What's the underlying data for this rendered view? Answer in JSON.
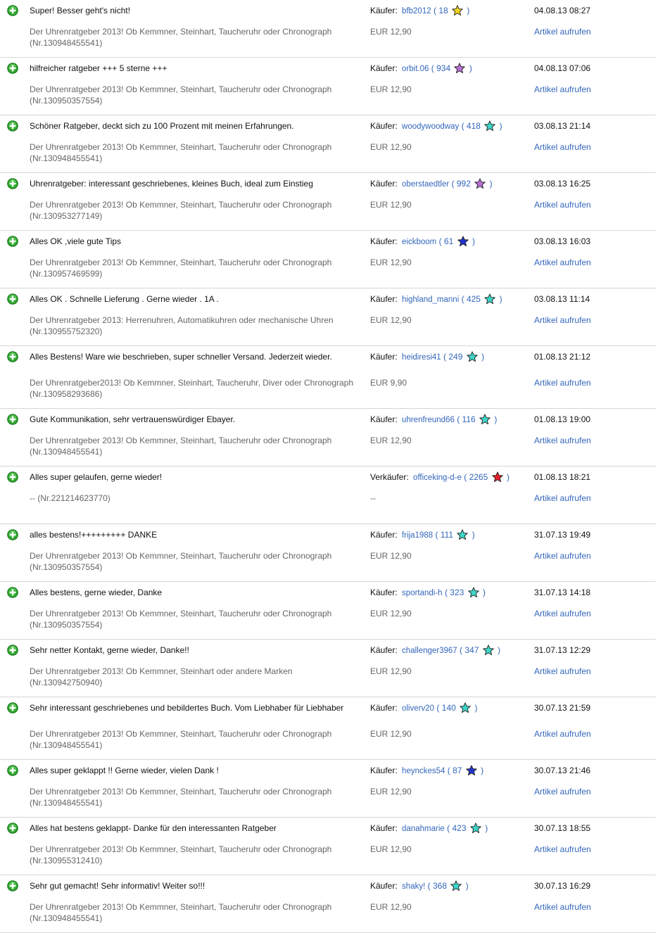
{
  "icons": {
    "positive": "plus-circle-icon",
    "star": "star-icon"
  },
  "colors": {
    "positive_icon": "#2fa82f",
    "link": "#3366bb",
    "star_yellow": "#f2d51f",
    "star_purple": "#b96fd6",
    "star_turquoise": "#3cd6c8",
    "star_blue": "#2233cc",
    "star_red": "#e3202a"
  },
  "feedback": [
    {
      "comment": "Super! Besser geht's nicht!",
      "item": "Der Uhrenratgeber 2013! Ob Kemmner, Steinhart, Taucheruhr oder Chronograph (Nr.130948455541)",
      "role": "Käufer:",
      "user": "bfb2012",
      "score": "18",
      "star": "yellow",
      "price": "EUR 12,90",
      "date": "04.08.13 08:27",
      "link": "Artikel aufrufen"
    },
    {
      "comment": "hilfreicher ratgeber +++ 5 sterne +++",
      "item": "Der Uhrenratgeber 2013! Ob Kemmner, Steinhart, Taucheruhr oder Chronograph (Nr.130950357554)",
      "role": "Käufer:",
      "user": "orbit.06",
      "score": "934",
      "star": "purple",
      "price": "EUR 12,90",
      "date": "04.08.13 07:06",
      "link": "Artikel aufrufen"
    },
    {
      "comment": "Schöner Ratgeber, deckt sich zu 100 Prozent mit meinen Erfahrungen.",
      "item": "Der Uhrenratgeber 2013! Ob Kemmner, Steinhart, Taucheruhr oder Chronograph (Nr.130948455541)",
      "role": "Käufer:",
      "user": "woodywoodway",
      "score": "418",
      "star": "turquoise",
      "price": "EUR 12,90",
      "date": "03.08.13 21:14",
      "link": "Artikel aufrufen"
    },
    {
      "comment": "Uhrenratgeber: interessant geschriebenes, kleines Buch, ideal zum Einstieg",
      "item": "Der Uhrenratgeber 2013! Ob Kemmner, Steinhart, Taucheruhr oder Chronograph (Nr.130953277149)",
      "role": "Käufer:",
      "user": "oberstaedtler",
      "score": "992",
      "star": "purple",
      "price": "EUR 12,90",
      "date": "03.08.13 16:25",
      "link": "Artikel aufrufen"
    },
    {
      "comment": "Alles OK ,viele gute Tips",
      "item": "Der Uhrenratgeber 2013! Ob Kemmner, Steinhart, Taucheruhr oder Chronograph (Nr.130957469599)",
      "role": "Käufer:",
      "user": "eickboom",
      "score": "61",
      "star": "blue",
      "price": "EUR 12,90",
      "date": "03.08.13 16:03",
      "link": "Artikel aufrufen"
    },
    {
      "comment": "Alles OK . Schnelle Lieferung . Gerne wieder . 1A .",
      "item": "Der Uhrenratgeber 2013: Herrenuhren, Automatikuhren oder mechanische Uhren (Nr.130955752320)",
      "role": "Käufer:",
      "user": "highland_manni",
      "score": "425",
      "star": "turquoise",
      "price": "EUR 12,90",
      "date": "03.08.13 11:14",
      "link": "Artikel aufrufen"
    },
    {
      "comment": "Alles Bestens! Ware wie beschrieben, super schneller Versand. Jederzeit wieder.",
      "item": "Der Uhrenratgeber2013! Ob Kemmner, Steinhart, Taucheruhr, Diver oder Chronograph (Nr.130958293686)",
      "role": "Käufer:",
      "user": "heidiresi41",
      "score": "249",
      "star": "turquoise",
      "price": "EUR 9,90",
      "date": "01.08.13 21:12",
      "link": "Artikel aufrufen"
    },
    {
      "comment": "Gute Kommunikation, sehr vertrauenswürdiger Ebayer.",
      "item": "Der Uhrenratgeber 2013! Ob Kemmner, Steinhart, Taucheruhr oder Chronograph (Nr.130948455541)",
      "role": "Käufer:",
      "user": "uhrenfreund66",
      "score": "116",
      "star": "turquoise",
      "price": "EUR 12,90",
      "date": "01.08.13 19:00",
      "link": "Artikel aufrufen"
    },
    {
      "comment": "Alles super gelaufen, gerne wieder!",
      "item": "-- (Nr.221214623770)",
      "role": "Verkäufer:",
      "user": "officeking-d-e",
      "score": "2265",
      "star": "red",
      "price": "--",
      "date": "01.08.13 18:21",
      "link": "Artikel aufrufen"
    },
    {
      "comment": "alles bestens!+++++++++ DANKE",
      "item": "Der Uhrenratgeber 2013! Ob Kemmner, Steinhart, Taucheruhr oder Chronograph (Nr.130950357554)",
      "role": "Käufer:",
      "user": "frija1988",
      "score": "111",
      "star": "turquoise",
      "price": "EUR 12,90",
      "date": "31.07.13 19:49",
      "link": "Artikel aufrufen"
    },
    {
      "comment": "Alles bestens, gerne wieder, Danke",
      "item": "Der Uhrenratgeber 2013! Ob Kemmner, Steinhart, Taucheruhr oder Chronograph (Nr.130950357554)",
      "role": "Käufer:",
      "user": "sportandi-h",
      "score": "323",
      "star": "turquoise",
      "price": "EUR 12,90",
      "date": "31.07.13 14:18",
      "link": "Artikel aufrufen"
    },
    {
      "comment": "Sehr netter Kontakt, gerne wieder, Danke!!",
      "item": "Der Uhrenratgeber 2013! Ob Kemmner, Steinhart oder andere Marken (Nr.130942750940)",
      "role": "Käufer:",
      "user": "challenger3967",
      "score": "347",
      "star": "turquoise",
      "price": "EUR 12,90",
      "date": "31.07.13 12:29",
      "link": "Artikel aufrufen"
    },
    {
      "comment": "Sehr interessant geschriebenes und bebildertes Buch. Vom Liebhaber für Liebhaber",
      "item": "Der Uhrenratgeber 2013! Ob Kemmner, Steinhart, Taucheruhr oder Chronograph (Nr.130948455541)",
      "role": "Käufer:",
      "user": "oliverv20",
      "score": "140",
      "star": "turquoise",
      "price": "EUR 12,90",
      "date": "30.07.13 21:59",
      "link": "Artikel aufrufen"
    },
    {
      "comment": "Alles super geklappt !! Gerne wieder, vielen Dank !",
      "item": "Der Uhrenratgeber 2013! Ob Kemmner, Steinhart, Taucheruhr oder Chronograph (Nr.130948455541)",
      "role": "Käufer:",
      "user": "heynckes54",
      "score": "87",
      "star": "blue",
      "price": "EUR 12,90",
      "date": "30.07.13 21:46",
      "link": "Artikel aufrufen"
    },
    {
      "comment": "Alles hat bestens geklappt- Danke für den interessanten Ratgeber",
      "item": "Der Uhrenratgeber 2013! Ob Kemmner, Steinhart, Taucheruhr oder Chronograph (Nr.130955312410)",
      "role": "Käufer:",
      "user": "danahmarie",
      "score": "423",
      "star": "turquoise",
      "price": "EUR 12,90",
      "date": "30.07.13 18:55",
      "link": "Artikel aufrufen"
    },
    {
      "comment": "Sehr gut gemacht! Sehr informativ! Weiter so!!!",
      "item": "Der Uhrenratgeber 2013! Ob Kemmner, Steinhart, Taucheruhr oder Chronograph (Nr.130948455541)",
      "role": "Käufer:",
      "user": "shaky!",
      "score": "368",
      "star": "turquoise",
      "price": "EUR 12,90",
      "date": "30.07.13 16:29",
      "link": "Artikel aufrufen"
    }
  ]
}
